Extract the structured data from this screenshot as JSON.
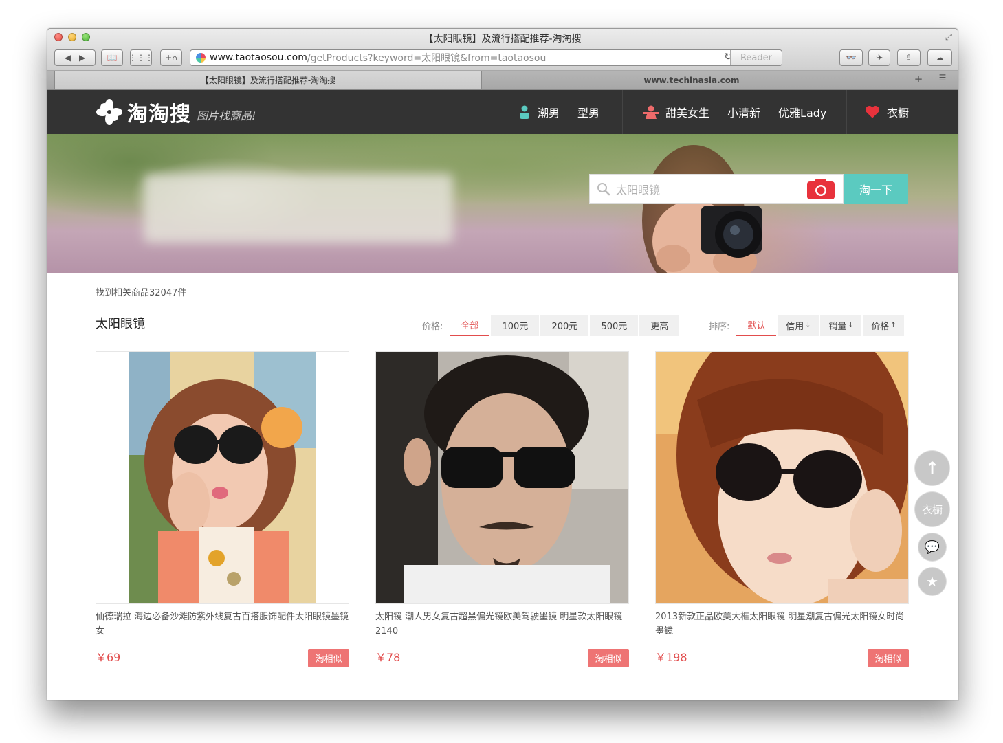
{
  "window": {
    "title": "【太阳眼镜】及流行搭配推荐-淘淘搜"
  },
  "toolbar": {
    "back_icon": "back-arrow-icon",
    "forward_icon": "forward-arrow-icon",
    "url_host": "www.taotaosou.com",
    "url_path": "/getProducts?keyword=太阳眼镜&from=taotaosou",
    "reader_label": "Reader"
  },
  "tabs": [
    {
      "label": "【太阳眼镜】及流行搭配推荐-淘淘搜",
      "active": true
    },
    {
      "label": "www.techinasia.com",
      "active": false
    }
  ],
  "site": {
    "logo_text": "淘淘搜",
    "slogan": "图片找商品!",
    "nav": {
      "male": [
        "潮男",
        "型男"
      ],
      "female": [
        "甜美女生",
        "小清新",
        "优雅Lady"
      ],
      "wardrobe": "衣橱"
    }
  },
  "search": {
    "placeholder": "太阳眼镜",
    "button_label": "淘一下"
  },
  "results": {
    "count_text": "找到相关商品32047件",
    "keyword": "太阳眼镜",
    "price_label": "价格:",
    "price_options": [
      "全部",
      "100元",
      "200元",
      "500元",
      "更高"
    ],
    "price_active": "全部",
    "sort_label": "排序:",
    "sort_options": [
      "默认",
      "信用",
      "销量",
      "价格"
    ],
    "sort_active": "默认"
  },
  "products": [
    {
      "title": "仙德瑞拉 海边必备沙滩防紫外线复古百搭服饰配件太阳眼镜墨镜女",
      "price": "￥69",
      "button": "淘相似"
    },
    {
      "title": "太阳镜 潮人男女复古超黑偏光镜欧美驾驶墨镜 明星款太阳眼镜2140",
      "price": "￥78",
      "button": "淘相似"
    },
    {
      "title": "2013新款正品欧美大框太阳眼镜 明星潮复古偏光太阳镜女时尚墨镜",
      "price": "￥198",
      "button": "淘相似"
    }
  ],
  "side_tools": {
    "wardrobe_label": "衣橱"
  },
  "colors": {
    "nav_bg": "#333333",
    "accent_red": "#e24d4d",
    "search_button": "#5bcac0",
    "similar_button": "#ee7474"
  }
}
